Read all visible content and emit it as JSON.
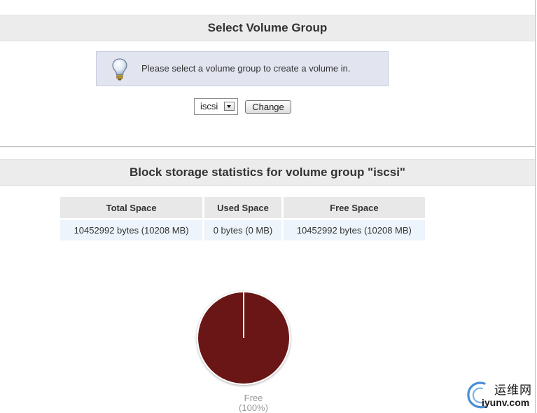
{
  "volume_select": {
    "title": "Select Volume Group",
    "hint": "Please select a volume group to create a volume in.",
    "hint_icon": "lightbulb-icon",
    "selected_group": "iscsi",
    "change_label": "Change"
  },
  "stats": {
    "title": "Block storage statistics for volume group \"iscsi\"",
    "columns": [
      "Total Space",
      "Used Space",
      "Free Space"
    ],
    "row": [
      "10452992 bytes (10208 MB)",
      "0 bytes (0 MB)",
      "10452992 bytes (10208 MB)"
    ]
  },
  "chart_data": {
    "type": "pie",
    "slices": [
      {
        "label": "Free",
        "value": 100,
        "display": "(100%)",
        "color": "#6a1616"
      }
    ],
    "units": "%"
  },
  "watermark": {
    "cn": "运维网",
    "en": "iyunv.com"
  },
  "colors": {
    "header_bg": "#ececec",
    "hint_bg": "#e2e4f0",
    "table_head_bg": "#e8e8e8",
    "table_cell_bg": "#edf4fb",
    "pie_free": "#6a1616"
  }
}
